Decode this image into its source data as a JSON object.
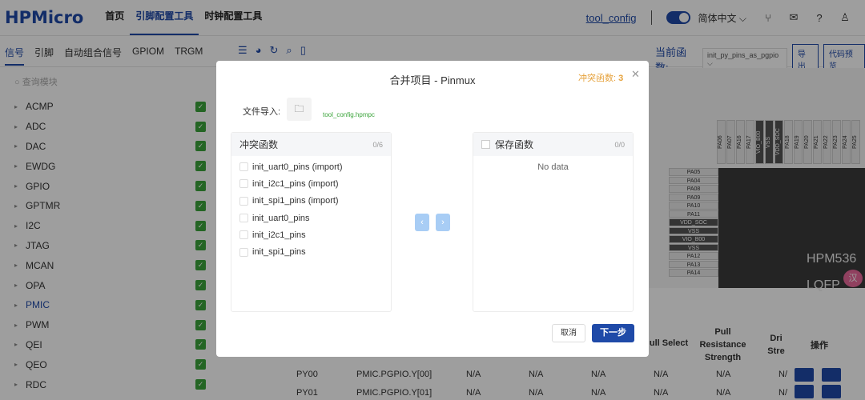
{
  "app": {
    "logo": "HPMicro",
    "nav": [
      "首页",
      "引脚配置工具",
      "时钟配置工具"
    ],
    "project_name": "tool_config",
    "language": "简体中文"
  },
  "tabs": [
    "信号",
    "引脚",
    "自动组合信号",
    "GPIOM",
    "TRGM"
  ],
  "toolbar": {
    "func_label": "当前函数:",
    "func_value": "init_py_pins_as_pgpio",
    "export": "导出",
    "preview": "代码预览"
  },
  "sidebar": {
    "search_placeholder": "查询模块",
    "items": [
      "ACMP",
      "ADC",
      "DAC",
      "EWDG",
      "GPIO",
      "GPTMR",
      "I2C",
      "JTAG",
      "MCAN",
      "OPA",
      "PMIC",
      "PWM",
      "QEI",
      "QEO",
      "RDC"
    ]
  },
  "chip": {
    "top_pins": [
      "PA06",
      "PA07",
      "PA16",
      "PA17",
      "VIO_B00",
      "VSS",
      "VDD_SOC",
      "PA18",
      "PA19",
      "PA20",
      "PA21",
      "PA22",
      "PA23",
      "PA24",
      "PA25"
    ],
    "left_pins": [
      "PA05",
      "PA04",
      "PA08",
      "PA09",
      "PA10",
      "PA11",
      "VDD_SOC",
      "VSS",
      "VIO_B00",
      "VSS",
      "PA12",
      "PA13",
      "PA14"
    ],
    "name": "HPM536",
    "name2": "LQFP"
  },
  "table": {
    "headers": {
      "pull_select": "ull Select",
      "pull_res": "Pull\nResistance\nStrength",
      "drive": "Dri\nStre",
      "ops": "操作"
    },
    "rows": [
      {
        "pin": "PY00",
        "func": "PMIC.PGPIO.Y[00]",
        "c1": "N/A",
        "c2": "N/A",
        "c3": "N/A",
        "c4": "N/A",
        "c5": "N/A",
        "c6": "N/"
      },
      {
        "pin": "PY01",
        "func": "PMIC.PGPIO.Y[01]",
        "c1": "N/A",
        "c2": "N/A",
        "c3": "N/A",
        "c4": "N/A",
        "c5": "N/A",
        "c6": "N/"
      }
    ]
  },
  "modal": {
    "title": "合并项目 - Pinmux",
    "conflict_label": "冲突函数:",
    "conflict_count": "3",
    "file_import_label": "文件导入:",
    "file_name": "tool_config.hpmpc",
    "left_panel": {
      "title": "冲突函数",
      "count": "0/6",
      "items": [
        "init_uart0_pins (import)",
        "init_i2c1_pins (import)",
        "init_spi1_pins (import)",
        "init_uart0_pins",
        "init_i2c1_pins",
        "init_spi1_pins"
      ]
    },
    "right_panel": {
      "title": "保存函数",
      "count": "0/0",
      "empty": "No data"
    },
    "cancel": "取消",
    "next": "下一步"
  },
  "avatar_text": "汉"
}
